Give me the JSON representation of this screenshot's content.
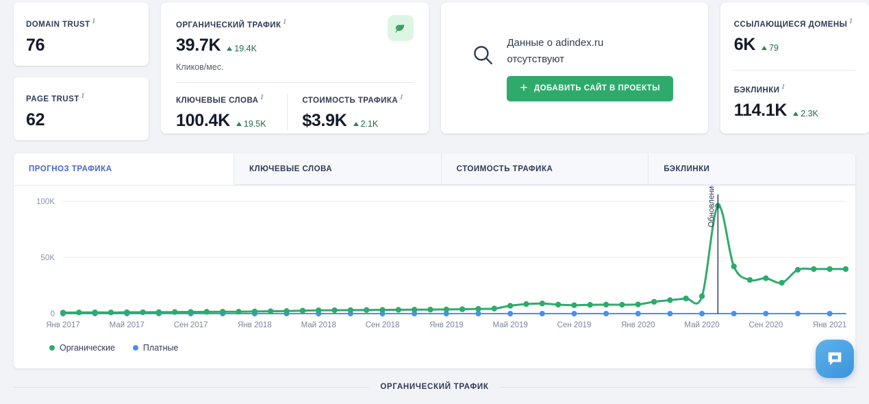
{
  "cards": {
    "domain_trust": {
      "label": "DOMAIN TRUST",
      "value": "76",
      "accent": "#f2b2c6"
    },
    "page_trust": {
      "label": "PAGE TRUST",
      "value": "62",
      "accent": "#f2d4a4"
    },
    "organic": {
      "label": "ОРГАНИЧЕСКИЙ ТРАФИК",
      "value": "39.7K",
      "delta": "19.4K",
      "sub": "Кликов/мес.",
      "badge_icon": "leaf-icon",
      "accent": "#a9dfba",
      "keywords": {
        "label": "КЛЮЧЕВЫЕ СЛОВА",
        "value": "100.4K",
        "delta": "19.5K"
      },
      "traffic_cost": {
        "label": "СТОИМОСТЬ ТРАФИКА",
        "value": "$3.9K",
        "delta": "2.1K"
      }
    },
    "nodata": {
      "icon": "search-icon",
      "text": "Данные о adindex.ru отсутствуют",
      "button_label": "ДОБАВИТЬ САЙТ В ПРОЕКТЫ",
      "button_color": "#2eab6b",
      "accent": "#b9cdf0"
    },
    "links": {
      "ref_domains": {
        "label": "ССЫЛАЮЩИЕСЯ ДОМЕНЫ",
        "value": "6K",
        "delta": "79"
      },
      "backlinks": {
        "label": "БЭКЛИНКИ",
        "value": "114.1K",
        "delta": "2.3K"
      }
    },
    "info_icon": "i"
  },
  "tabs": [
    {
      "label": "ПРОГНОЗ ТРАФИКА",
      "active": true
    },
    {
      "label": "КЛЮЧЕВЫЕ СЛОВА",
      "active": false
    },
    {
      "label": "СТОИМОСТЬ ТРАФИКА",
      "active": false
    },
    {
      "label": "БЭКЛИНКИ",
      "active": false
    }
  ],
  "legend": [
    {
      "label": "Органические",
      "color": "#2eab6b"
    },
    {
      "label": "Платные",
      "color": "#4a8ff0"
    }
  ],
  "annotation": {
    "label": "Обновление базы",
    "color": "#253455"
  },
  "section_divider": {
    "label": "ОРГАНИЧЕСКИЙ ТРАФИК"
  },
  "chat": {
    "icon": "chat-bubble-icon"
  },
  "chart_data": {
    "type": "line",
    "title": "",
    "xlabel": "",
    "ylabel": "",
    "ylim": [
      0,
      100000
    ],
    "yticks": [
      0,
      50000,
      100000
    ],
    "ytick_labels": [
      "0",
      "50K",
      "100K"
    ],
    "grid": true,
    "legend_position": "bottom-left",
    "x": [
      "Янв 2017",
      "Фев 2017",
      "Мар 2017",
      "Апр 2017",
      "Май 2017",
      "Июн 2017",
      "Июл 2017",
      "Авг 2017",
      "Сен 2017",
      "Окт 2017",
      "Ноя 2017",
      "Дек 2017",
      "Янв 2018",
      "Фев 2018",
      "Мар 2018",
      "Апр 2018",
      "Май 2018",
      "Июн 2018",
      "Июл 2018",
      "Авг 2018",
      "Сен 2018",
      "Окт 2018",
      "Ноя 2018",
      "Дек 2018",
      "Янв 2019",
      "Фев 2019",
      "Мар 2019",
      "Апр 2019",
      "Май 2019",
      "Июн 2019",
      "Июл 2019",
      "Авг 2019",
      "Сен 2019",
      "Окт 2019",
      "Ноя 2019",
      "Дек 2019",
      "Янв 2020",
      "Фев 2020",
      "Мар 2020",
      "Апр 2020",
      "Май 2020",
      "Июн 2020",
      "Июл 2020",
      "Авг 2020",
      "Сен 2020",
      "Окт 2020",
      "Ноя 2020",
      "Дек 2020",
      "Янв 2021",
      "Фев 2021"
    ],
    "xtick_labels": [
      "Янв 2017",
      "Май 2017",
      "Сен 2017",
      "Янв 2018",
      "Май 2018",
      "Сен 2018",
      "Янв 2019",
      "Май 2019",
      "Сен 2019",
      "Янв 2020",
      "Май 2020",
      "Сен 2020",
      "Янв 2021"
    ],
    "xtick_indices": [
      0,
      4,
      8,
      12,
      16,
      20,
      24,
      28,
      32,
      36,
      40,
      44,
      48
    ],
    "series": [
      {
        "name": "Органические",
        "color": "#2eab6b",
        "values": [
          900,
          1000,
          1100,
          1000,
          1200,
          1200,
          1300,
          1400,
          1500,
          1600,
          1700,
          1700,
          1900,
          2100,
          2300,
          2600,
          2900,
          3000,
          3100,
          3200,
          3300,
          3400,
          3500,
          3600,
          3700,
          3900,
          4200,
          4500,
          7000,
          8500,
          9000,
          8000,
          7500,
          7800,
          8000,
          7900,
          8200,
          10500,
          12000,
          13500,
          15500,
          96000,
          42000,
          30000,
          31500,
          27500,
          39000,
          39700,
          39700,
          39700
        ]
      },
      {
        "name": "Платные",
        "color": "#4a8ff0",
        "values": [
          0,
          0,
          0,
          0,
          0,
          0,
          0,
          0,
          0,
          0,
          0,
          0,
          0,
          0,
          0,
          0,
          0,
          0,
          0,
          0,
          0,
          0,
          0,
          0,
          0,
          0,
          0,
          0,
          0,
          0,
          0,
          0,
          0,
          0,
          0,
          0,
          0,
          0,
          0,
          0,
          0,
          0,
          0,
          0,
          0,
          0,
          0,
          0,
          0,
          0
        ]
      }
    ],
    "annotation_line": {
      "label": "Обновление базы",
      "x_index": 41,
      "color": "#253455"
    }
  }
}
